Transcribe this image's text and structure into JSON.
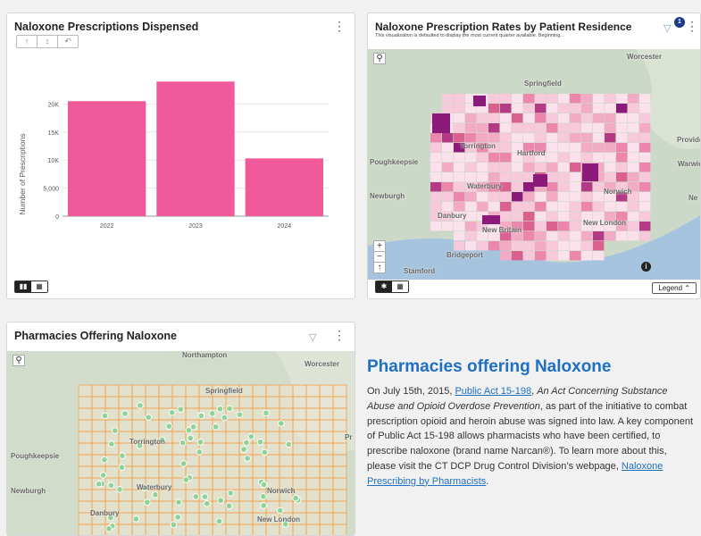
{
  "card1": {
    "title": "Naloxone Prescriptions Dispensed",
    "tool_icons": [
      "↑",
      "↕",
      "↶"
    ],
    "ylabel": "Number of Prescriptions"
  },
  "chart_data": {
    "type": "bar",
    "categories": [
      "2022",
      "2023",
      "2024"
    ],
    "values": [
      20500,
      24000,
      10300
    ],
    "ylabel": "Number of Prescriptions",
    "ytick_labels": [
      "0",
      "5,000",
      "10K",
      "15K",
      "20K"
    ],
    "ylim": [
      0,
      25000
    ],
    "bar_color": "#f0599a",
    "grid": true
  },
  "card2": {
    "title": "Naloxone Prescription Rates by Patient Residence",
    "subtitle": "This visualization is defaulted to display the most current quarter available. Beginning...",
    "badge": "1",
    "legend_label": "Legend",
    "map_labels": [
      "Worcester",
      "Springfield",
      "Torrington",
      "Hartford",
      "Providence",
      "Poughkeepsie",
      "Waterbury",
      "Norwich",
      "Danbury",
      "New Britain",
      "New London",
      "Bridgeport",
      "Stamford",
      "Warwick",
      "Newburgh",
      "Ne"
    ]
  },
  "card3": {
    "title": "Pharmacies Offering Naloxone",
    "map_labels": [
      "Northampton",
      "Worcester",
      "Springfield",
      "Torrington",
      "Poughkeepsie",
      "Waterbury",
      "Norwich",
      "Newburgh",
      "Danbury",
      "New London",
      "Pr"
    ]
  },
  "text": {
    "heading": "Pharmacies offering Naloxone",
    "p_start": "On July 15th, 2015, ",
    "link1": "Public Act 15-198",
    "p_mid1": ", ",
    "italic": "An Act Concerning Substance Abuse and Opioid Overdose Prevention",
    "p_mid2": ", as part of the initiative to combat prescription opioid and heroin abuse was signed into law. A key component of Public Act 15-198 allows pharmacists who have been certified, to prescribe naloxone (brand name Narcan®). To learn more about this, please visit the CT DCP Drug Control Division’s webpage, ",
    "link2": "Naloxone Prescribing by Pharmacists",
    "p_end": "."
  },
  "colors": {
    "accent": "#1f6fc3",
    "bar": "#f0599a",
    "choropleth_dark": "#8b1a7a",
    "choropleth_light": "#fbe1ec",
    "pharmacy_dot": "#8fd39a",
    "county_line": "#f2a24c"
  }
}
